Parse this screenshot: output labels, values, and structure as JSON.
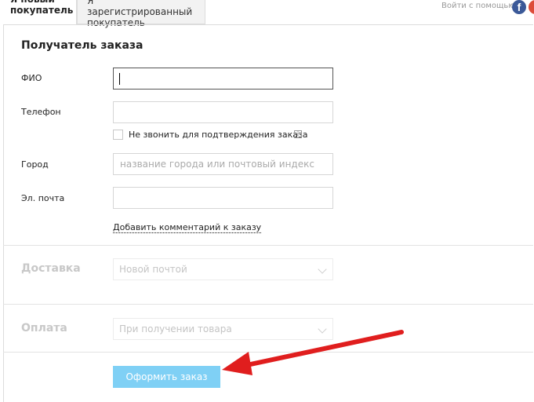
{
  "tabs": {
    "new_customer": "Я новый покупатель",
    "registered_customer": "Я зарегистрированный покупатель"
  },
  "social": {
    "label": "Войти с помощью",
    "icons": [
      "facebook-icon",
      "google-icon"
    ]
  },
  "recipient": {
    "title": "Получатель заказа",
    "fio_label": "ФИО",
    "fio_value": "",
    "phone_label": "Телефон",
    "phone_value": "",
    "no_call_label": "Не звонить для подтверждения заказа",
    "no_call_checked": false,
    "city_label": "Город",
    "city_placeholder": "название города или почтовый индекс",
    "email_label": "Эл. почта",
    "email_value": "",
    "add_comment_link": "Добавить комментарий к заказу"
  },
  "delivery": {
    "title": "Доставка",
    "selected": "Новой почтой"
  },
  "payment": {
    "title": "Оплата",
    "selected": "При получении товара"
  },
  "submit_label": "Оформить заказ",
  "colors": {
    "submit_bg": "#7fd0f5",
    "arrow": "#e01e1e",
    "facebook": "#3b5998"
  }
}
